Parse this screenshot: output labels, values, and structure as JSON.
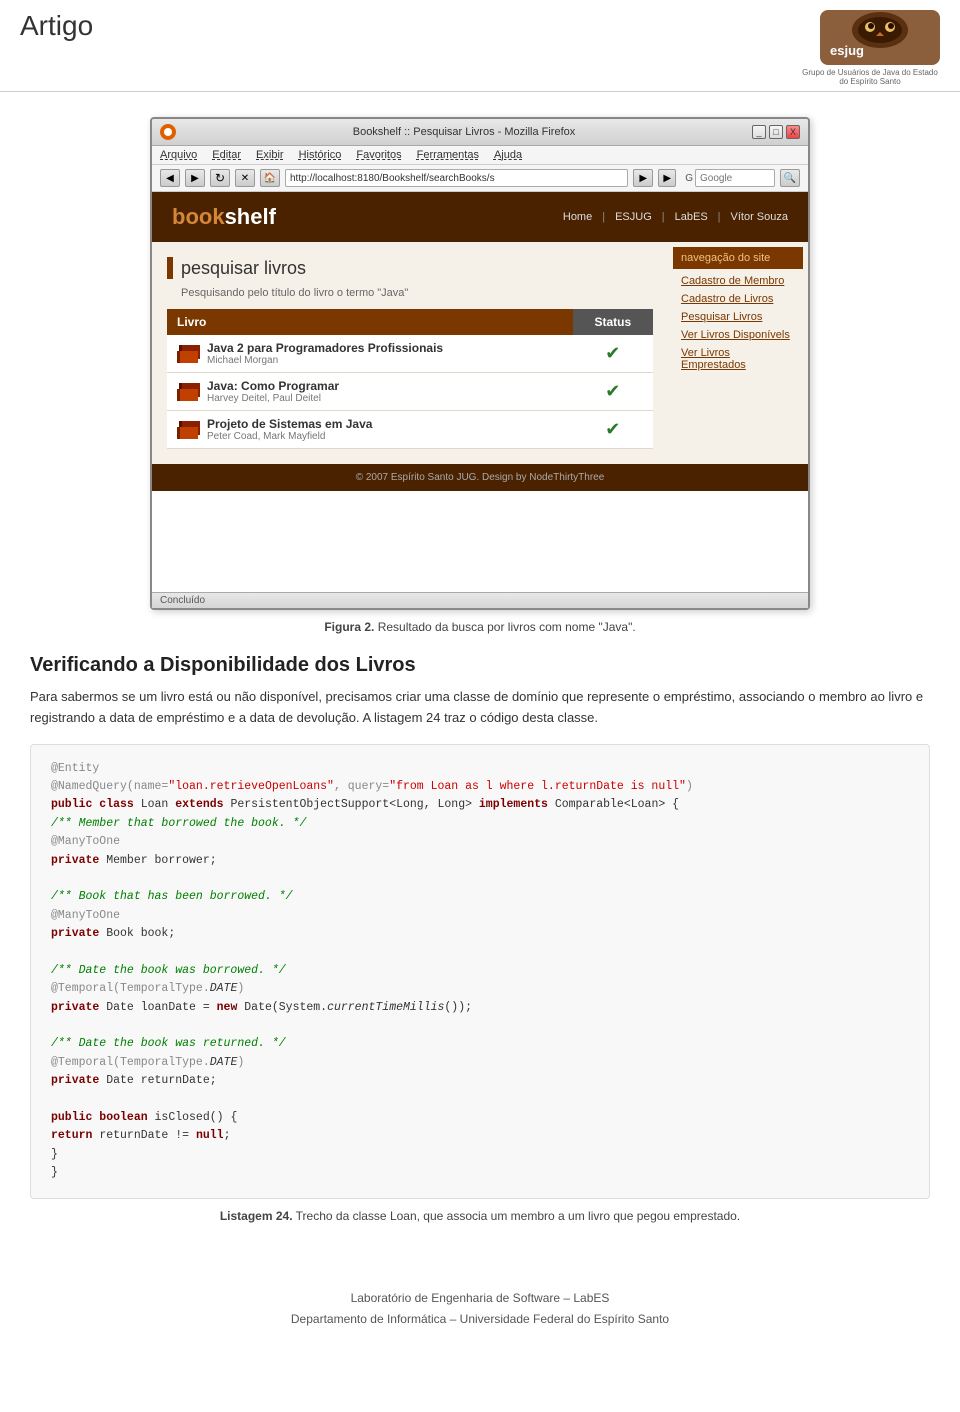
{
  "page": {
    "title": "Artigo"
  },
  "header": {
    "title": "Artigo",
    "logo_text": "esjug",
    "logo_subtitle": "Grupo de Usuários de Java do Estado do Espírito Santo"
  },
  "browser": {
    "title": "Bookshelf :: Pesquisar Livros - Mozilla Firefox",
    "url": "http://localhost:8180/Bookshelf/searchBooks/s",
    "menu_items": [
      "Arquivo",
      "Editar",
      "Exibir",
      "Histórico",
      "Favoritos",
      "Ferramentas",
      "Ajuda"
    ],
    "status": "Concluído",
    "window_btns": [
      "_",
      "□",
      "X"
    ]
  },
  "bookshelf_app": {
    "logo_book": "book",
    "logo_shelf": "shelf",
    "nav_links": [
      "Home",
      "ESJUG",
      "LabES",
      "Vítor Souza"
    ],
    "nav_label": "navegação do site",
    "nav_label_rest": " do site",
    "sidebar_links": [
      "Cadastro de Membro",
      "Cadastro de Livros",
      "Pesquisar Livros",
      "Ver Livros Disponívels",
      "Ver Livros Emprestados"
    ],
    "page_heading": "pesquisar livros",
    "search_subtitle": "Pesquisando pelo título do livro o termo \"Java\"",
    "table_cols": [
      "Livro",
      "Status"
    ],
    "books": [
      {
        "title": "Java 2 para Programadores Profissionais",
        "author": "Michael Morgan",
        "available": true
      },
      {
        "title": "Java: Como Programar",
        "author": "Harvey Deitel, Paul Deitel",
        "available": true
      },
      {
        "title": "Projeto de Sistemas em Java",
        "author": "Peter Coad, Mark Mayfield",
        "available": true
      }
    ],
    "footer_text": "© 2007 Espírito Santo JUG. Design by NodeThirtyThree"
  },
  "figure": {
    "number": "Figura 2.",
    "caption": "Resultado da busca por livros com nome \"Java\"."
  },
  "section": {
    "heading": "Verificando a Disponibilidade dos Livros",
    "text": "Para sabermos se um livro está ou não disponível, precisamos criar uma classe de domínio que represente o empréstimo, associando o membro ao livro e registrando a data de empréstimo e a data de devolução. A listagem 24 traz o código desta classe."
  },
  "code": {
    "lines": [
      {
        "type": "annotation",
        "text": "@Entity"
      },
      {
        "type": "mixed",
        "parts": [
          {
            "t": "ann",
            "v": "@NamedQuery(name="
          },
          {
            "t": "str",
            "v": "\"loan.retrieveOpenLoans\""
          },
          {
            "t": "ann",
            "v": ", query="
          },
          {
            "t": "str",
            "v": "\"from Loan as l where l.returnDate is null\""
          },
          {
            "t": "ann",
            "v": ")"
          }
        ]
      },
      {
        "type": "mixed",
        "parts": [
          {
            "t": "kw",
            "v": "public class"
          },
          {
            "t": "plain",
            "v": " Loan "
          },
          {
            "t": "kw",
            "v": "extends"
          },
          {
            "t": "plain",
            "v": " PersistentObjectSupport<Long, Long> "
          },
          {
            "t": "kw",
            "v": "implements"
          },
          {
            "t": "plain",
            "v": " Comparable<Loan> {"
          }
        ]
      },
      {
        "type": "comment",
        "text": "    /** Member that borrowed the book. */"
      },
      {
        "type": "annotation",
        "text": "    @ManyToOne"
      },
      {
        "type": "mixed",
        "parts": [
          {
            "t": "plain",
            "v": "    "
          },
          {
            "t": "kw",
            "v": "private"
          },
          {
            "t": "plain",
            "v": " Member borrower;"
          }
        ]
      },
      {
        "type": "blank"
      },
      {
        "type": "comment",
        "text": "    /** Book that has been borrowed. */"
      },
      {
        "type": "annotation",
        "text": "    @ManyToOne"
      },
      {
        "type": "mixed",
        "parts": [
          {
            "t": "plain",
            "v": "    "
          },
          {
            "t": "kw",
            "v": "private"
          },
          {
            "t": "plain",
            "v": " Book book;"
          }
        ]
      },
      {
        "type": "blank"
      },
      {
        "type": "comment",
        "text": "    /** Date the book was borrowed. */"
      },
      {
        "type": "mixed",
        "parts": [
          {
            "t": "ann",
            "v": "    @Temporal(TemporalType."
          },
          {
            "t": "it",
            "v": "DATE"
          },
          {
            "t": "ann",
            "v": ")"
          }
        ]
      },
      {
        "type": "mixed",
        "parts": [
          {
            "t": "plain",
            "v": "    "
          },
          {
            "t": "kw",
            "v": "private"
          },
          {
            "t": "plain",
            "v": " Date loanDate = "
          },
          {
            "t": "kw",
            "v": "new"
          },
          {
            "t": "plain",
            "v": " Date(System."
          },
          {
            "t": "it",
            "v": "currentTimeMillis"
          },
          {
            "t": "plain",
            "v": "());"
          }
        ]
      },
      {
        "type": "blank"
      },
      {
        "type": "comment",
        "text": "    /** Date the book was returned. */"
      },
      {
        "type": "mixed",
        "parts": [
          {
            "t": "ann",
            "v": "    @Temporal(TemporalType."
          },
          {
            "t": "it",
            "v": "DATE"
          },
          {
            "t": "ann",
            "v": ")"
          }
        ]
      },
      {
        "type": "mixed",
        "parts": [
          {
            "t": "plain",
            "v": "    "
          },
          {
            "t": "kw",
            "v": "private"
          },
          {
            "t": "plain",
            "v": " Date returnDate;"
          }
        ]
      },
      {
        "type": "blank"
      },
      {
        "type": "mixed",
        "parts": [
          {
            "t": "plain",
            "v": "    "
          },
          {
            "t": "kw",
            "v": "public boolean"
          },
          {
            "t": "plain",
            "v": " isClosed() {"
          }
        ]
      },
      {
        "type": "mixed",
        "parts": [
          {
            "t": "plain",
            "v": "        "
          },
          {
            "t": "kw",
            "v": "return"
          },
          {
            "t": "plain",
            "v": " returnDate != "
          },
          {
            "t": "kw",
            "v": "null"
          },
          {
            "t": "plain",
            "v": ";"
          }
        ]
      },
      {
        "type": "plain",
        "text": "    }"
      },
      {
        "type": "plain",
        "text": "}"
      }
    ]
  },
  "listing": {
    "number": "Listagem 24.",
    "caption": "Trecho da classe Loan, que associa um membro a um livro que pegou emprestado."
  },
  "footer": {
    "line1": "Laboratório de Engenharia de Software – LabES",
    "line2": "Departamento de Informática – Universidade Federal do Espírito Santo"
  }
}
